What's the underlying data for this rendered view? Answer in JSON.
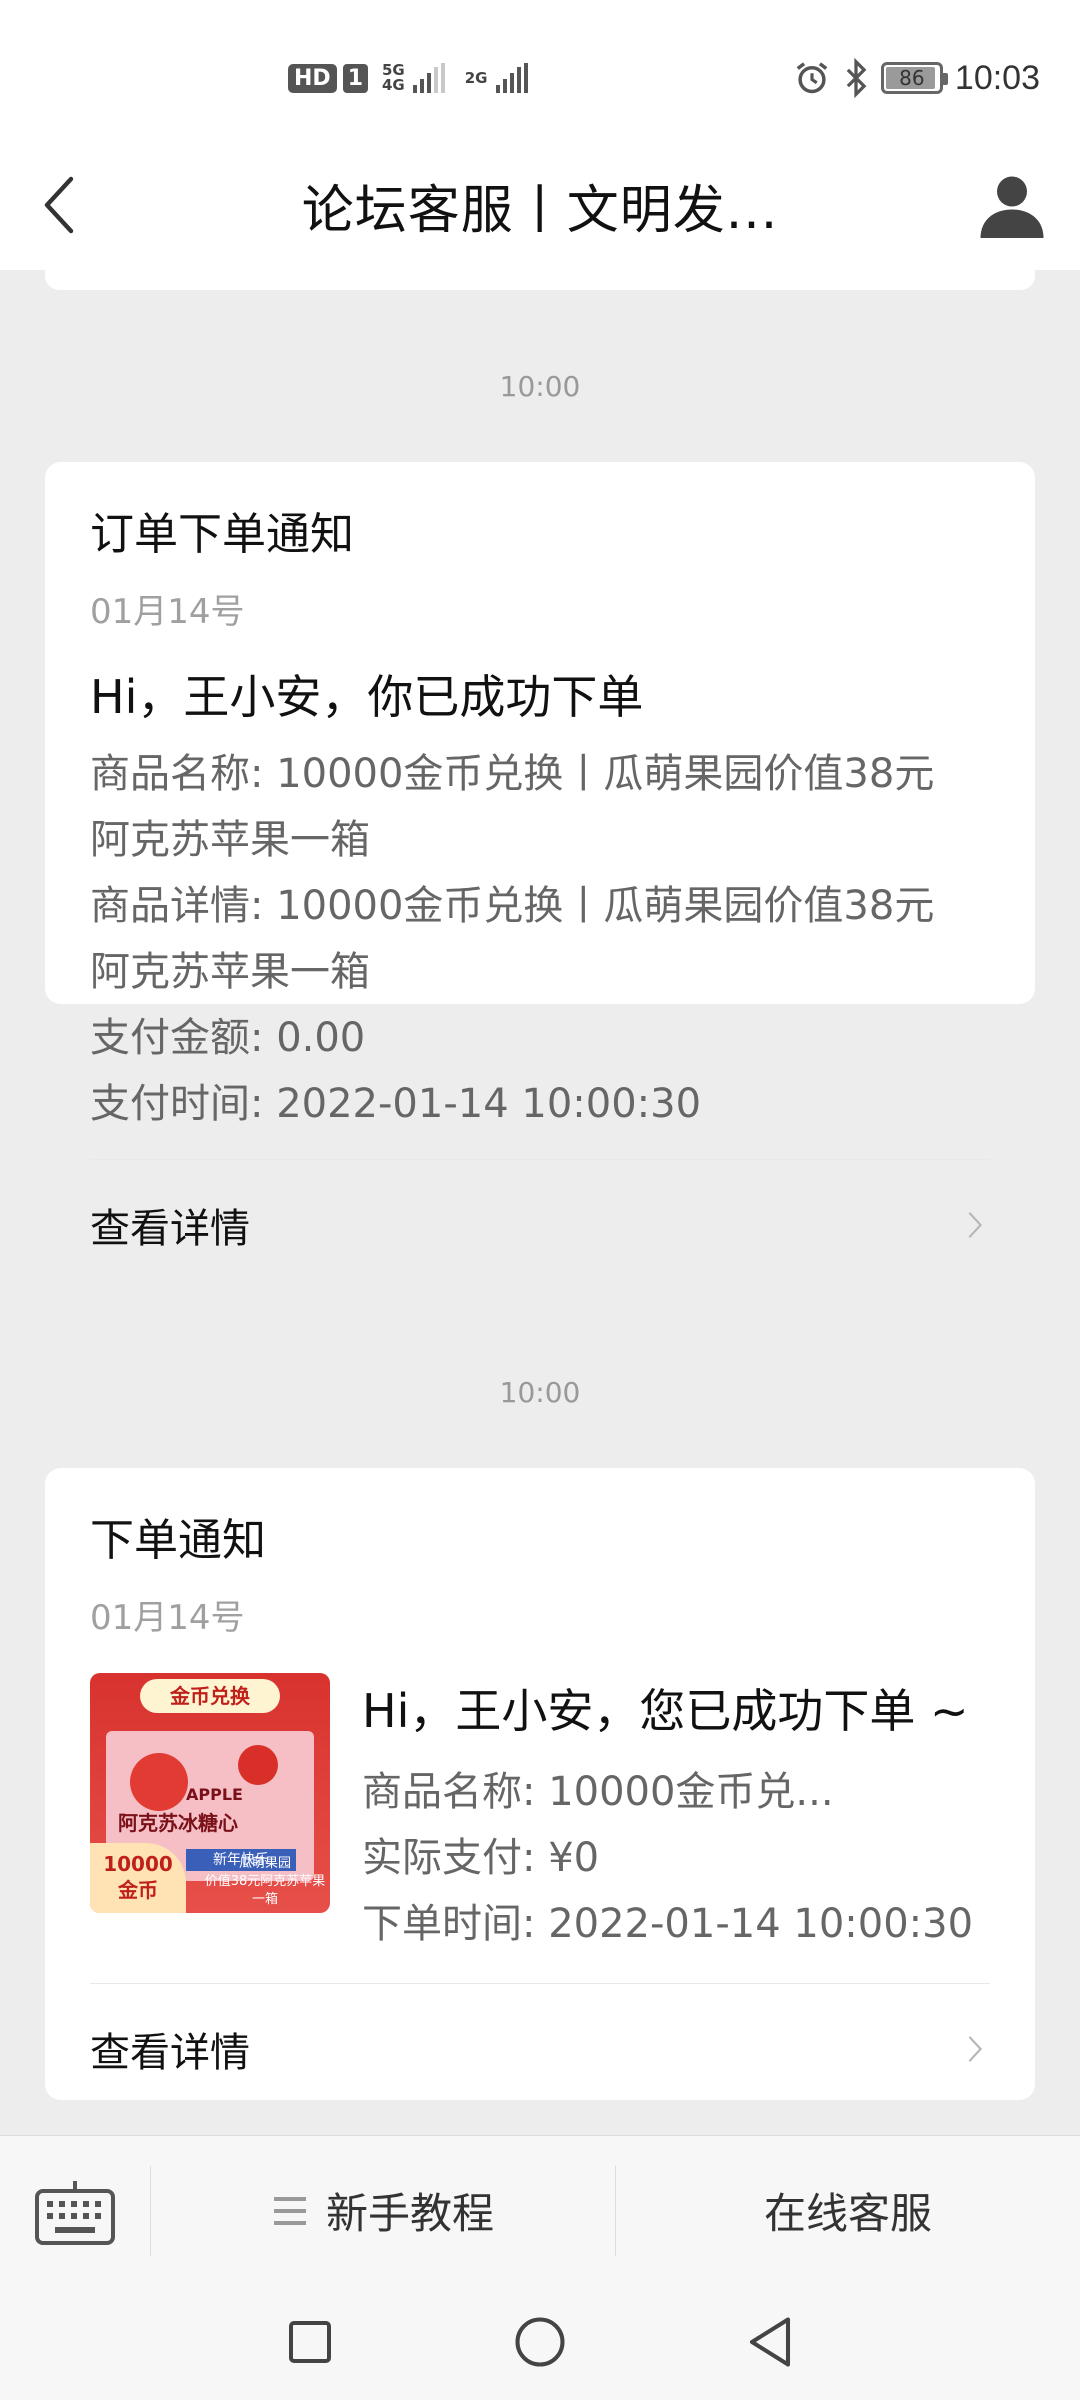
{
  "status_bar": {
    "hd": "HD",
    "sim": "1",
    "net1": "5G",
    "net1_sub": "4G",
    "net2": "2G",
    "battery": "86",
    "time": "10:03"
  },
  "header": {
    "title": "论坛客服丨文明发...",
    "back_icon": "chevron-left-icon",
    "profile_icon": "person-icon"
  },
  "messages": [
    {
      "time": "10:00",
      "title": "订单下单通知",
      "date": "01月14号",
      "greeting": "Hi，王小安，你已成功下单",
      "details": [
        "商品名称: 10000金币兑换丨瓜萌果园价值38元",
        "阿克苏苹果一箱",
        "商品详情: 10000金币兑换丨瓜萌果园价值38元",
        "阿克苏苹果一箱",
        "支付金额: 0.00",
        "支付时间: 2022-01-14 10:00:30"
      ],
      "footer": "查看详情"
    },
    {
      "time": "10:00",
      "title": "下单通知",
      "date": "01月14号",
      "greeting": "Hi，王小安，您已成功下单 ~",
      "thumb": {
        "banner": "金币兑换",
        "brand": "APPLE",
        "name": "阿克苏冰糖心",
        "ribbon": "新年快乐",
        "coin_amount": "10000",
        "coin_label": "金币",
        "seller": "瓜萌果园",
        "desc": "价值38元阿克苏苹果一箱"
      },
      "details": [
        "商品名称: 10000金币兑...",
        "实际支付: ¥0",
        "下单时间: 2022-01-14 10:00:30"
      ],
      "footer": "查看详情"
    }
  ],
  "bottom_bar": {
    "keyboard_icon": "keyboard-icon",
    "menu1": "新手教程",
    "menu2": "在线客服"
  }
}
